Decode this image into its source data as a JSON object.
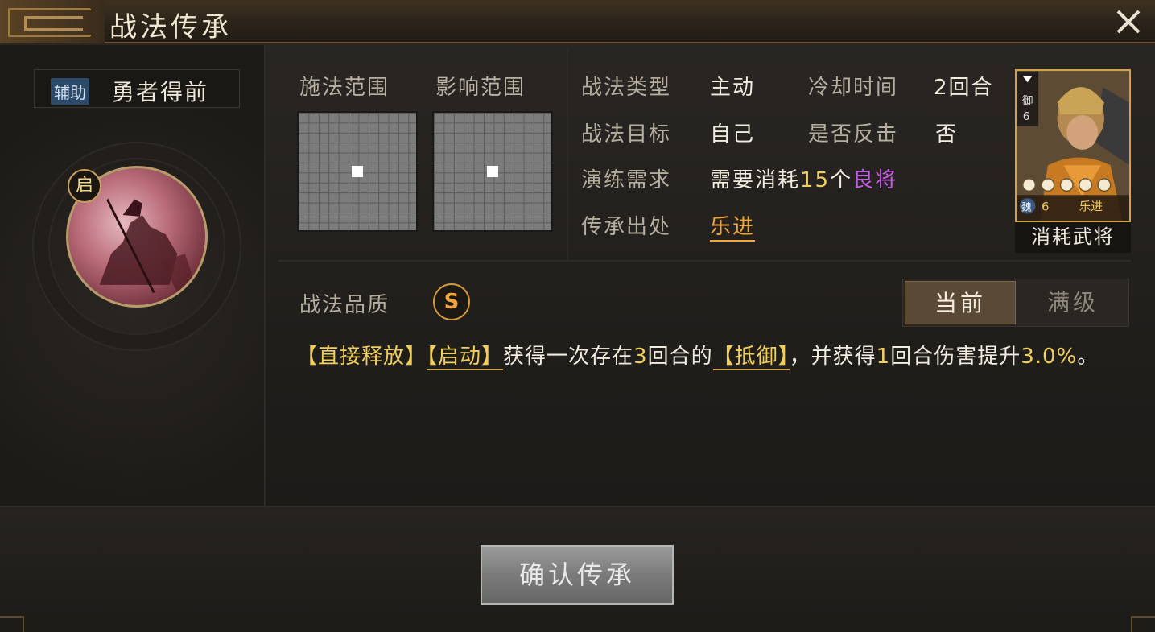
{
  "window": {
    "title": "战法传承"
  },
  "skill": {
    "tag": "辅助",
    "name": "勇者得前",
    "start_badge": "启"
  },
  "ranges": {
    "cast_label": "施法范围",
    "effect_label": "影响范围"
  },
  "info": {
    "type_label": "战法类型",
    "type_value": "主动",
    "cooldown_label": "冷却时间",
    "cooldown_value": "2回合",
    "target_label": "战法目标",
    "target_value": "自己",
    "counter_label": "是否反击",
    "counter_value": "否",
    "train_label": "演练需求",
    "train_prefix": "需要消耗",
    "train_count": "15",
    "train_unit": "个",
    "train_item": "良将",
    "source_label": "传承出处",
    "source_value": "乐进"
  },
  "general_card": {
    "troop_type": "御",
    "troop_level": "6",
    "faction": "魏",
    "level": "6",
    "name": "乐进",
    "caption": "消耗武将"
  },
  "quality": {
    "label": "战法品质",
    "grade": "S"
  },
  "toggle": {
    "current": "当前",
    "max": "满级"
  },
  "description": {
    "tag1": "【直接释放】",
    "tag2": "【启动】",
    "text1": "获得一次存在",
    "num1": "3",
    "text2": "回合的",
    "tag3": "【抵御】",
    "text3": "，并获得",
    "num2": "1",
    "text4": "回合伤害提升",
    "num3": "3.0%",
    "text5": "。"
  },
  "footer": {
    "confirm_label": "确认传承"
  },
  "colors": {
    "accent_gold": "#f2cf5b",
    "link_orange": "#f0a63a",
    "purple": "#c35ce6"
  }
}
